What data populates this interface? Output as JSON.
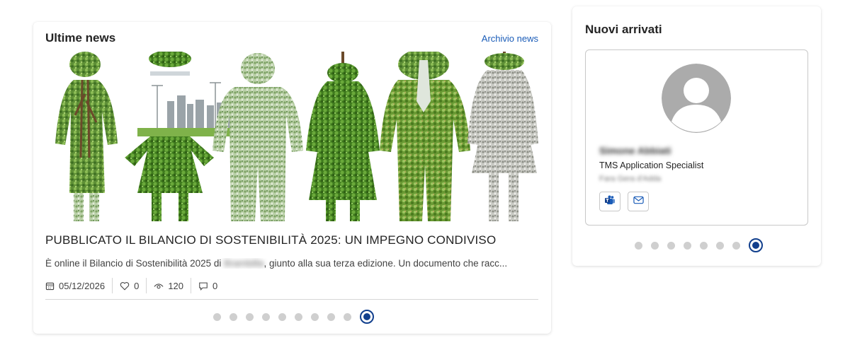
{
  "news": {
    "title": "Ultime news",
    "archive_link": "Archivio news",
    "article": {
      "headline": "PUBBLICATO IL BILANCIO DI SOSTENIBILITÀ 2025: UN IMPEGNO CONDIVISO",
      "excerpt_before": "È online il Bilancio di Sostenibilità 2025 di",
      "excerpt_redacted": "Brambilla",
      "excerpt_after": ", giunto alla sua terza edizione. Un documento che racc...",
      "date": "05/12/2026",
      "likes": "0",
      "views": "120",
      "comments": "0"
    },
    "carousel": {
      "total": 10,
      "active_index": 9
    }
  },
  "new_arrivals": {
    "title": "Nuovi arrivati",
    "person": {
      "name": "Simone Abbiati",
      "role": "TMS Application Specialist",
      "location": "Fara Gera d'Adda"
    },
    "carousel": {
      "total": 8,
      "active_index": 7
    }
  },
  "colors": {
    "accent": "#113f8d",
    "link": "#1a5cb8",
    "dot_inactive": "#cfcfcf",
    "avatar_bg": "#ababab"
  },
  "icons": [
    "calendar-icon",
    "heart-icon",
    "eye-icon",
    "comment-icon",
    "teams-icon",
    "mail-icon",
    "person-silhouette-icon"
  ]
}
